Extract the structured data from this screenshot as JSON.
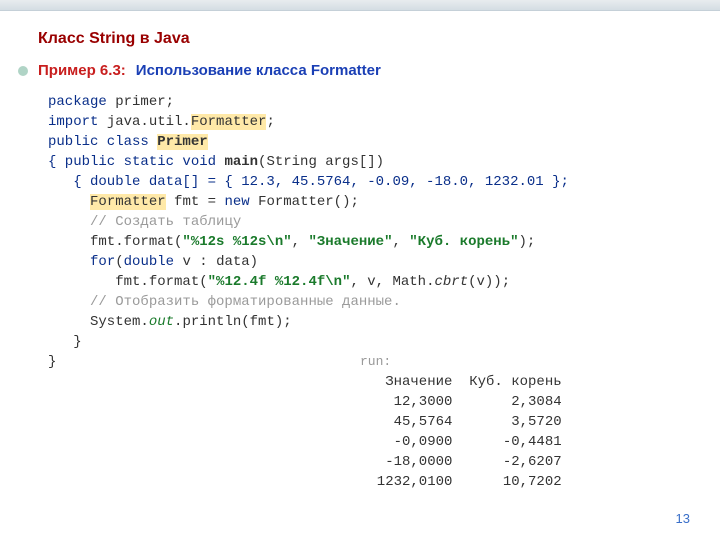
{
  "title": "Класс String в Java",
  "example": {
    "label": "Пример 6.3:",
    "desc": "Использование класса Formatter"
  },
  "code": {
    "l1": {
      "kw": "package",
      "rest": " primer;"
    },
    "l2": {
      "kw": "import",
      "rest1": " java.util.",
      "hl": "Formatter",
      "rest2": ";"
    },
    "l3a": "public class ",
    "l3b": "Primer",
    "l4": "{ public static void ",
    "l4b": "main",
    "l4c": "(String args[])",
    "l5": "   { double data[] = { 12.3, 45.5764, -0.09, -18.0, 1232.01 };",
    "l6a": "     ",
    "l6hl": "Formatter",
    "l6b": " fmt = ",
    "l6kw": "new",
    "l6c": " Formatter();",
    "l7": "     // Создать таблицу",
    "l8a": "     fmt.format(",
    "l8s1": "\"%12s %12s\\n\"",
    "l8b": ", ",
    "l8s2": "\"Значение\"",
    "l8c": ", ",
    "l8s3": "\"Куб. корень\"",
    "l8d": ");",
    "l9kw": "for",
    "l9a": "(",
    "l9kw2": "double",
    "l9b": " v : data)",
    "l10a": "        fmt.format(",
    "l10s": "\"%12.4f %12.4f\\n\"",
    "l10b": ", v, Math.",
    "l10i": "cbrt",
    "l10c": "(v));",
    "l11": "     // Отобразить форматированные данные.",
    "l12a": "     System.",
    "l12o": "out",
    "l12b": ".println(fmt);",
    "l13": "   }",
    "l14": "}"
  },
  "run_label": "run:",
  "out": {
    "h": "   Значение  Куб. корень",
    "r1": "    12,3000       2,3084",
    "r2": "    45,5764       3,5720",
    "r3": "    -0,0900      -0,4481",
    "r4": "   -18,0000      -2,6207",
    "r5": "  1232,0100      10,7202"
  },
  "page_number": "13",
  "chart_data": {
    "type": "table",
    "title": "Formatter output",
    "columns": [
      "Значение",
      "Куб. корень"
    ],
    "rows": [
      [
        12.3,
        2.3084
      ],
      [
        45.5764,
        3.572
      ],
      [
        -0.09,
        -0.4481
      ],
      [
        -18.0,
        -2.6207
      ],
      [
        1232.01,
        10.7202
      ]
    ]
  }
}
